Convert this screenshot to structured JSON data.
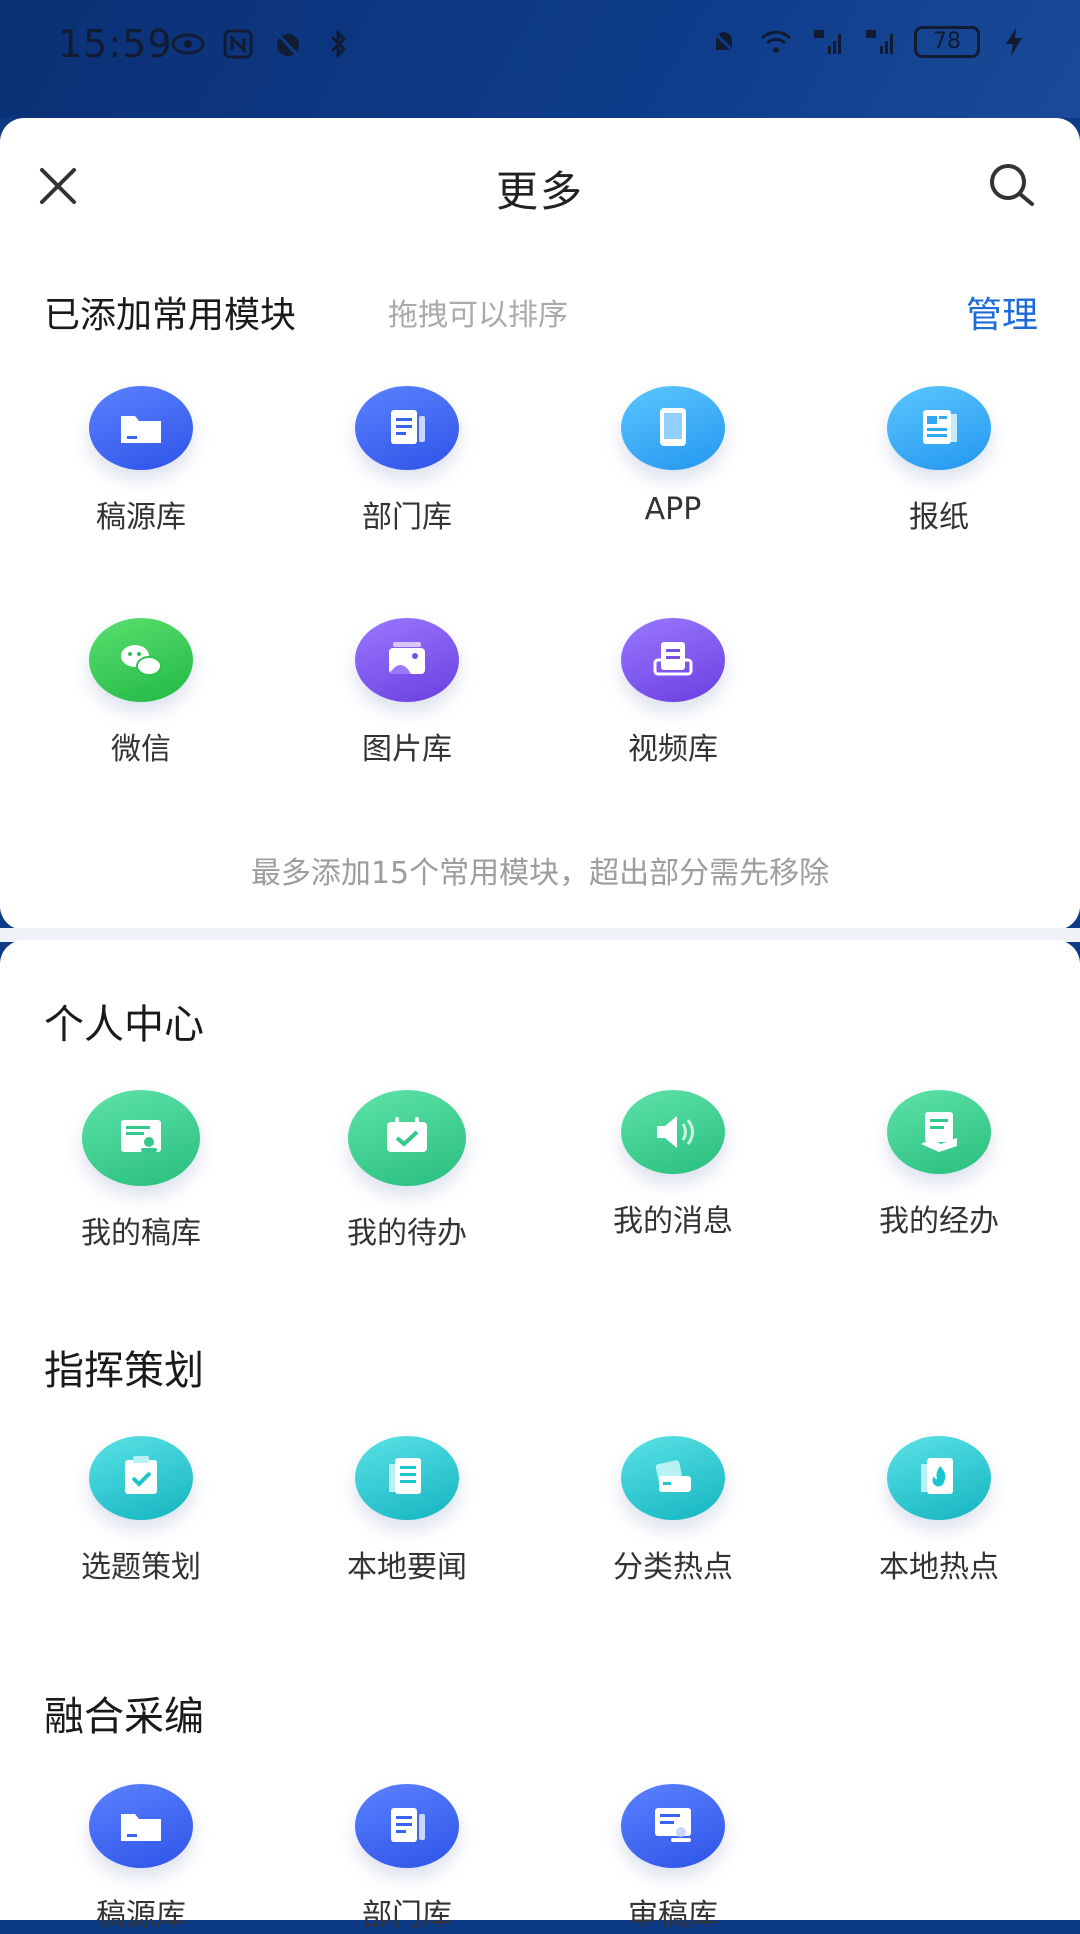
{
  "status": {
    "time": "15:59",
    "battery": "78"
  },
  "header": {
    "title": "更多"
  },
  "added": {
    "title": "已添加常用模块",
    "hint": "拖拽可以排序",
    "manage": "管理",
    "tip": "最多添加15个常用模块，超出部分需先移除",
    "items": [
      {
        "label": "稿源库",
        "icon": "folder-icon",
        "color": "#3a62f0"
      },
      {
        "label": "部门库",
        "icon": "doc-icon",
        "color": "#3a62f0"
      },
      {
        "label": "APP",
        "icon": "tablet-icon",
        "color": "#2fa7f3"
      },
      {
        "label": "报纸",
        "icon": "newspaper-icon",
        "color": "#2fa7f3"
      },
      {
        "label": "微信",
        "icon": "wechat-icon",
        "color": "#2cc54d"
      },
      {
        "label": "图片库",
        "icon": "photo-icon",
        "color": "#7a4fe6"
      },
      {
        "label": "视频库",
        "icon": "video-library-icon",
        "color": "#7a4fe6"
      }
    ]
  },
  "personal": {
    "title": "个人中心",
    "items": [
      {
        "label": "我的稿库",
        "icon": "id-card-icon",
        "color": "#33c98a"
      },
      {
        "label": "我的待办",
        "icon": "calendar-check-icon",
        "color": "#33c98a"
      },
      {
        "label": "我的消息",
        "icon": "speaker-icon",
        "color": "#33c98a"
      },
      {
        "label": "我的经办",
        "icon": "handover-doc-icon",
        "color": "#33c98a"
      }
    ]
  },
  "command": {
    "title": "指挥策划",
    "items": [
      {
        "label": "选题策划",
        "icon": "clipboard-check-icon",
        "color": "#1cc6cf"
      },
      {
        "label": "本地要闻",
        "icon": "news-doc-icon",
        "color": "#1cc6cf"
      },
      {
        "label": "分类热点",
        "icon": "card-stack-icon",
        "color": "#1cc6cf"
      },
      {
        "label": "本地热点",
        "icon": "flame-doc-icon",
        "color": "#1cc6cf"
      }
    ]
  },
  "fusion": {
    "title": "融合采编",
    "items": [
      {
        "label": "稿源库",
        "icon": "folder-icon",
        "color": "#3a62f0"
      },
      {
        "label": "部门库",
        "icon": "doc-icon",
        "color": "#3a62f0"
      },
      {
        "label": "审稿库",
        "icon": "review-doc-icon",
        "color": "#3a62f0"
      }
    ]
  }
}
